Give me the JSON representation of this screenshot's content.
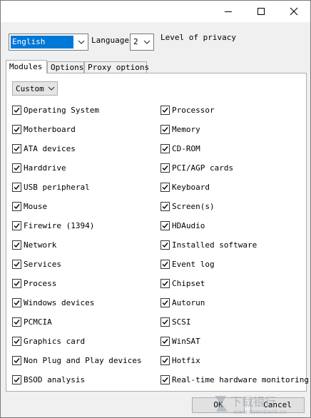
{
  "title_bar": {
    "minimize_icon": "minimize-icon",
    "maximize_icon": "maximize-icon",
    "close_icon": "close-icon"
  },
  "top": {
    "language_value": "English",
    "language_label": "Language",
    "level_value": "2",
    "level_label": "Level of privacy"
  },
  "tabs": [
    {
      "label": "Modules"
    },
    {
      "label": "Options"
    },
    {
      "label": "Proxy options"
    }
  ],
  "modules": {
    "mode_value": "Custom",
    "left": [
      {
        "label": "Operating System",
        "checked": true
      },
      {
        "label": "Motherboard",
        "checked": true
      },
      {
        "label": "ATA devices",
        "checked": true
      },
      {
        "label": "Harddrive",
        "checked": true
      },
      {
        "label": "USB peripheral",
        "checked": true
      },
      {
        "label": "Mouse",
        "checked": true
      },
      {
        "label": "Firewire (1394)",
        "checked": true
      },
      {
        "label": "Network",
        "checked": true
      },
      {
        "label": "Services",
        "checked": true
      },
      {
        "label": "Process",
        "checked": true
      },
      {
        "label": "Windows devices",
        "checked": true
      },
      {
        "label": "PCMCIA",
        "checked": true
      },
      {
        "label": "Graphics card",
        "checked": true
      },
      {
        "label": "Non Plug and Play devices",
        "checked": true
      },
      {
        "label": "BSOD analysis",
        "checked": true
      }
    ],
    "right": [
      {
        "label": "Processor",
        "checked": true
      },
      {
        "label": "Memory",
        "checked": true
      },
      {
        "label": "CD-ROM",
        "checked": true
      },
      {
        "label": "PCI/AGP cards",
        "checked": true
      },
      {
        "label": "Keyboard",
        "checked": true
      },
      {
        "label": "Screen(s)",
        "checked": true
      },
      {
        "label": "HDAudio",
        "checked": true
      },
      {
        "label": "Installed software",
        "checked": true
      },
      {
        "label": "Event log",
        "checked": true
      },
      {
        "label": "Chipset",
        "checked": true
      },
      {
        "label": "Autorun",
        "checked": true
      },
      {
        "label": "SCSI",
        "checked": true
      },
      {
        "label": "WinSAT",
        "checked": true
      },
      {
        "label": "Hotfix",
        "checked": true
      },
      {
        "label": "Real-time hardware monitoring",
        "checked": true
      }
    ]
  },
  "buttons": {
    "ok": "OK",
    "cancel": "Cancel"
  },
  "watermark": {
    "text": "下载银行",
    "sub": "www.downbank.cn"
  }
}
